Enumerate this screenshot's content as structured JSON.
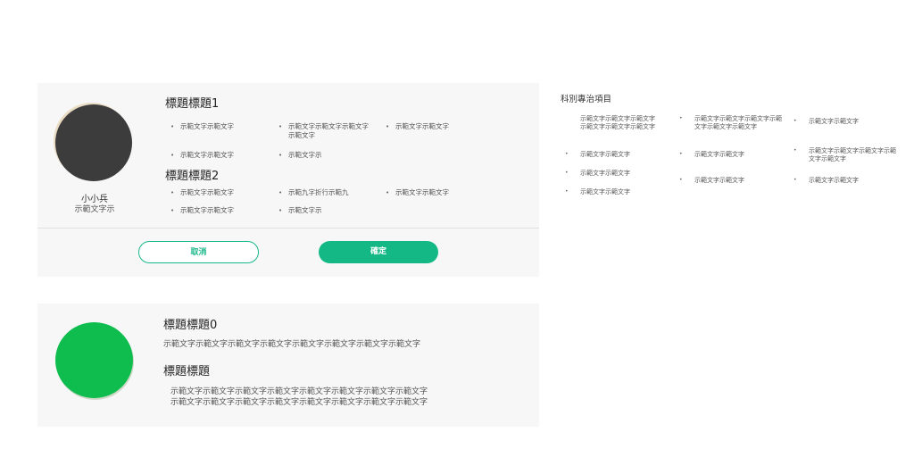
{
  "card1": {
    "person": {
      "name": "小小兵",
      "subtitle": "示範文字示"
    },
    "section1": {
      "title": "標題標題1",
      "items": [
        "示範文字示範文字",
        "示範文字示範文字示範文字示範文字",
        "示範文字示範文字",
        "示範文字示範文字",
        "示範文字示"
      ]
    },
    "section2": {
      "title": "標題標題2",
      "items": [
        "示範文字示範文字",
        "示範九字折行示範九",
        "示範文字示範文字",
        "示範文字示範文字",
        "示範文字示"
      ]
    },
    "buttons": {
      "cancel": "取消",
      "confirm": "確定"
    }
  },
  "card2": {
    "heading0": "標題標題0",
    "text0": "示範文字示範文字示範文字示範文字示範文字示範文字示範文字示範文字",
    "heading": "標題標題",
    "text_line1": "示範文字示範文字示範文字示範文字示範文字示範文字示範文字示範文字",
    "text_line2": "示範文字示範文字示範文字示範文字示範文字示範文字示範文字示範文字"
  },
  "side": {
    "title": "科別專治項目",
    "items": [
      "示範文字示範文字示範文字示範文字示範文字示範文字",
      "示範文字示範文字示範文字示範文字示範文字示範文字",
      "示範文字示範文字",
      "示範文字示範文字",
      "示範文字示範文字",
      "示範文字示範文字示範文字示範文字示範文字",
      "示範文字示範文字",
      "示範文字示範文字",
      "示範文字示範文字",
      "示範文字示範文字"
    ]
  }
}
